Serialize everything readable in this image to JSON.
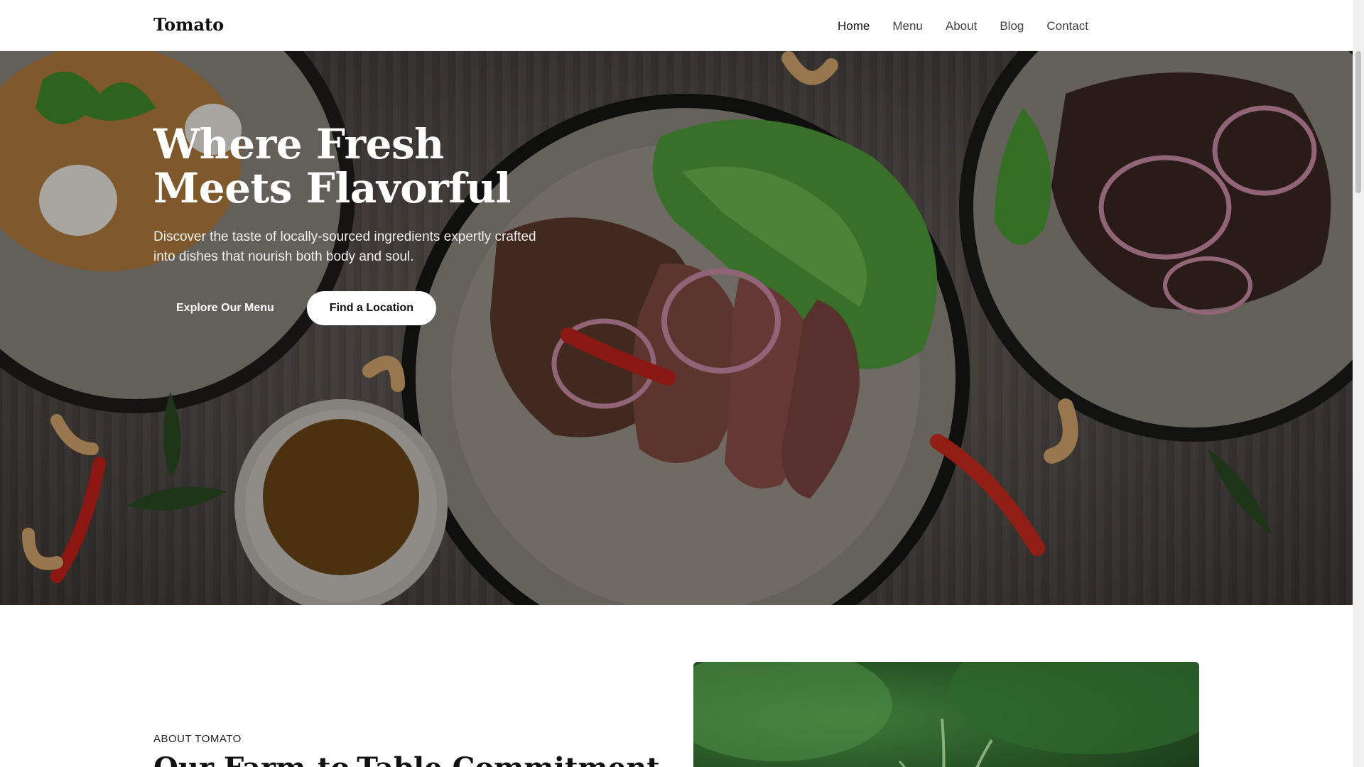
{
  "brand": {
    "name": "Tomato"
  },
  "nav": {
    "items": [
      {
        "label": "Home",
        "active": true
      },
      {
        "label": "Menu",
        "active": false
      },
      {
        "label": "About",
        "active": false
      },
      {
        "label": "Blog",
        "active": false
      },
      {
        "label": "Contact",
        "active": false
      }
    ]
  },
  "hero": {
    "title_line1": "Where Fresh",
    "title_line2": "Meets Flavorful",
    "subtitle": "Discover the taste of locally-sourced ingredients expertly crafted into dishes that nourish both body and soul.",
    "primary_button": "Explore Our Menu",
    "secondary_button": "Find a Location"
  },
  "about": {
    "eyebrow": "ABOUT TOMATO",
    "heading": "Our Farm-to-Table Commitment"
  },
  "colors": {
    "accent": "#ffffff",
    "text_dark": "#111111",
    "hero_overlay": "#000000"
  }
}
